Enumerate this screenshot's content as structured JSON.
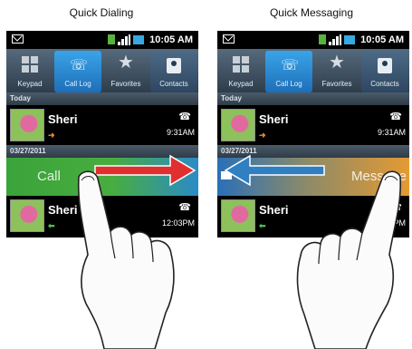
{
  "captions": {
    "left": "Quick Dialing",
    "right": "Quick Messaging"
  },
  "status": {
    "time": "10:05 AM"
  },
  "tabs": [
    {
      "label": "Keypad",
      "icon": "keypad-icon"
    },
    {
      "label": "Call Log",
      "icon": "call-log-icon"
    },
    {
      "label": "Favorites",
      "icon": "star-icon"
    },
    {
      "label": "Contacts",
      "icon": "contacts-icon"
    }
  ],
  "sections": {
    "today": "Today",
    "date": "03/27/2011"
  },
  "entries": [
    {
      "name": "Sheri",
      "time": "9:31AM"
    },
    {
      "name": "Sheri",
      "time_left": "12:03PM",
      "time_right": "PM"
    }
  ],
  "swipes": {
    "call": "Call",
    "message": "Message"
  },
  "colors": {
    "call": "#3ea73a",
    "message": "#f3a533",
    "arrow_right": "#e02f2f",
    "arrow_left": "#2f7fc1"
  }
}
